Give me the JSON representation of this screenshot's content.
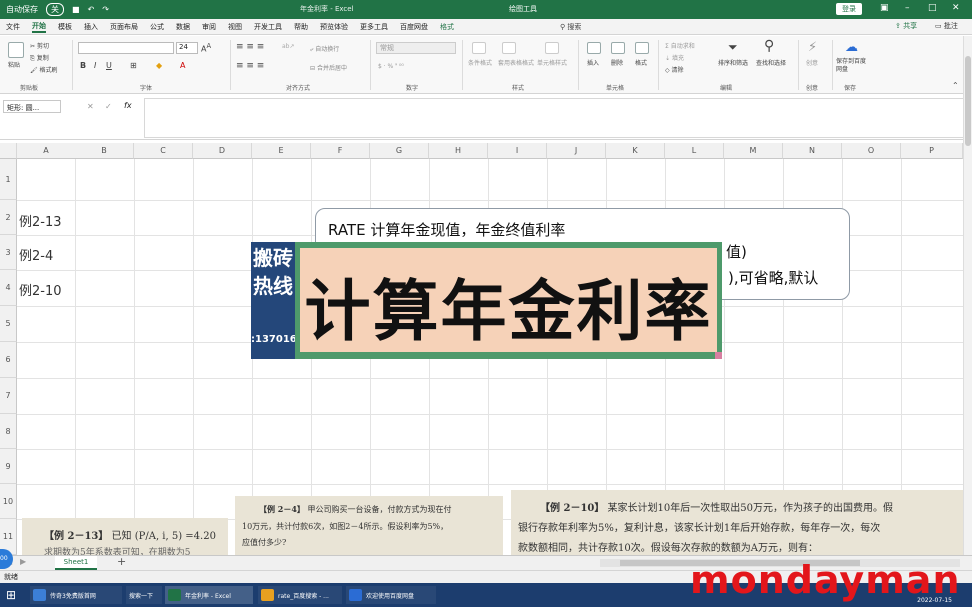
{
  "titlebar": {
    "autosave": "自动保存",
    "autosave_state": "关",
    "doc_title": "年金利率 - Excel",
    "drawing_tools": "绘图工具",
    "login": "登录"
  },
  "tabs": [
    "文件",
    "开始",
    "模板",
    "插入",
    "页面布局",
    "公式",
    "数据",
    "审阅",
    "视图",
    "开发工具",
    "帮助",
    "预览体验",
    "更多工具",
    "百度网盘",
    "格式"
  ],
  "active_tab": "开始",
  "tell_me": "搜索",
  "share": "共享",
  "comment": "批注",
  "ribbon": {
    "clipboard": {
      "label": "剪贴板",
      "paste": "粘贴",
      "cut": "剪切",
      "copy": "复制",
      "format_painter": "格式刷"
    },
    "font": {
      "label": "字体",
      "name": "",
      "size": "24"
    },
    "alignment": {
      "label": "对齐方式",
      "wrap": "自动换行",
      "merge": "合并后居中"
    },
    "number": {
      "label": "数字",
      "format": "常规"
    },
    "styles": {
      "label": "样式",
      "cond": "条件格式",
      "table": "套用表格格式",
      "cell": "单元格样式"
    },
    "cells": {
      "label": "单元格",
      "insert": "插入",
      "delete": "删除",
      "format": "格式"
    },
    "editing": {
      "label": "编辑",
      "autosum": "自动求和",
      "fill": "填充",
      "clear": "清除",
      "sort": "排序和筛选",
      "find": "查找和选择"
    },
    "ideas": {
      "label": "创意",
      "btn": "创意"
    },
    "save": {
      "label": "保存",
      "btn": "保存到百度网盘"
    }
  },
  "formula_bar": {
    "namebox": "矩形: 圆...",
    "fx": "fx",
    "content": ""
  },
  "columns": [
    "A",
    "B",
    "C",
    "D",
    "E",
    "F",
    "G",
    "H",
    "I",
    "J",
    "K",
    "L",
    "M",
    "N",
    "O",
    "P"
  ],
  "rows": [
    "1",
    "2",
    "3",
    "4",
    "5",
    "6",
    "7",
    "8",
    "9",
    "10",
    "11"
  ],
  "cells": {
    "a2": "例2-13",
    "a3": "例2-4",
    "a4": "例2-10"
  },
  "callout": {
    "line1": "RATE 计算年金现值，年金终值利率",
    "line2": "值)",
    "line3": "),可省略,默认"
  },
  "overlay_blue": {
    "line1": "搬",
    "line1b": "砖",
    "line2": "热",
    "line2b": "线",
    "number": ":137016"
  },
  "banner": {
    "text": "计算年金利率"
  },
  "book_excerpts": [
    {
      "title": "【例 2－13】",
      "text": "已知 (P/A, i, 5) =4.20",
      "text2": "求期数为5年系数表可知，在期数为5"
    },
    {
      "title": "【例 2－4】",
      "text": "甲公司购买一台设备，付款方式为现在付",
      "text2": "10万元，共计付款6次，如图2－4所示。假设利率为5%，",
      "text3": "应值付多少?"
    },
    {
      "title": "【例 2－10】",
      "text": "某家长计划10年后一次性取出50万元，作为孩子的出国费用。假",
      "text2": "银行存款年利率为5%，复利计息，该家长计划1年后开始存款，每年存一次，每次",
      "text3": "款数额相同，共计存款10次。假设每次存款的数额为A万元，则有："
    }
  ],
  "sheet": {
    "name": "Sheet1",
    "add": "+"
  },
  "status": {
    "text": "就绪"
  },
  "taskbar": {
    "items": [
      "传奇3免费版首网",
      "搜索一下",
      "年金利率 - Excel",
      "rate_百度搜索 - ...",
      "欢迎使用百度网盘"
    ],
    "date": "2022-07-15"
  },
  "watermark": "mondayman",
  "colors": {
    "excel_green": "#217346",
    "banner_green": "#4e9a6b",
    "banner_fill": "#f6d2b8",
    "blue_overlay": "#24477a",
    "watermark_red": "#e3161b"
  }
}
